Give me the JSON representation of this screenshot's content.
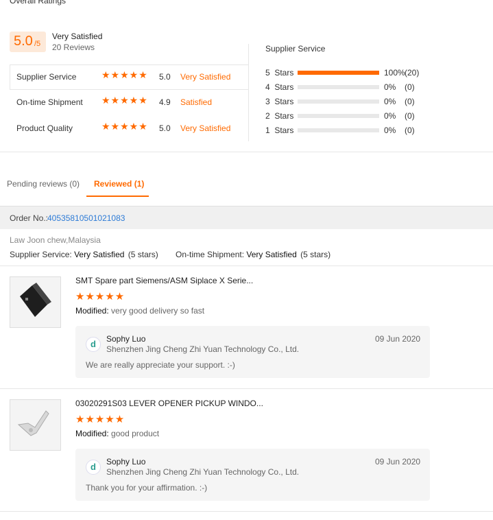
{
  "ratings": {
    "heading": "Overall Ratings",
    "score": "5.0",
    "score_suffix": "/5",
    "summary": "Very Satisfied",
    "review_count": "20 Reviews",
    "rows": [
      {
        "label": "Supplier Service",
        "stars": 5,
        "value": "5.0",
        "verdict": "Very Satisfied"
      },
      {
        "label": "On-time Shipment",
        "stars": 5,
        "value": "4.9",
        "verdict": "Satisfied"
      },
      {
        "label": "Product Quality",
        "stars": 5,
        "value": "5.0",
        "verdict": "Very Satisfied"
      }
    ]
  },
  "distribution": {
    "title": "Supplier Service",
    "rows": [
      {
        "label": "5  Stars",
        "fraction": 1.0,
        "percent": "100%",
        "count": "(20)"
      },
      {
        "label": "4  Stars",
        "fraction": 0,
        "percent": "0%",
        "count": "(0)"
      },
      {
        "label": "3  Stars",
        "fraction": 0,
        "percent": "0%",
        "count": "(0)"
      },
      {
        "label": "2  Stars",
        "fraction": 0,
        "percent": "0%",
        "count": "(0)"
      },
      {
        "label": "1  Stars",
        "fraction": 0,
        "percent": "0%",
        "count": "(0)"
      }
    ]
  },
  "tabs": [
    {
      "label": "Pending reviews (0)",
      "active": false
    },
    {
      "label": "Reviewed (1)",
      "active": true
    }
  ],
  "order": {
    "label": "Order No.:",
    "number": "40535810501021083",
    "buyer": "Law Joon chew,Malaysia",
    "service_label": "Supplier Service:",
    "service_value": "Very Satisfied",
    "service_stars": "(5 stars)",
    "shipment_label": "On-time Shipment:",
    "shipment_value": "Very Satisfied",
    "shipment_stars": "(5 stars)"
  },
  "reviews": [
    {
      "product": "SMT Spare part Siemens/ASM Siplace X Serie...",
      "stars": 5,
      "modified_label": "Modified:",
      "comment": "very good delivery so fast",
      "reply_name": "Sophy Luo",
      "reply_company": "Shenzhen Jing Cheng Zhi Yuan Technology Co., Ltd.",
      "reply_date": "09 Jun 2020",
      "reply_text": "We are really appreciate your support. :-)"
    },
    {
      "product": "03020291S03 LEVER OPENER PICKUP WINDO...",
      "stars": 5,
      "modified_label": "Modified:",
      "comment": "good product",
      "reply_name": "Sophy Luo",
      "reply_company": "Shenzhen Jing Cheng Zhi Yuan Technology Co., Ltd.",
      "reply_date": "09 Jun 2020",
      "reply_text": "Thank you for your affirmation. :-)"
    }
  ],
  "colors": {
    "accent": "#ff6a00",
    "link": "#2d7bd6",
    "score_bg": "#fde9d9"
  },
  "icons": {
    "star": "star-icon",
    "logo": "company-logo-icon"
  }
}
